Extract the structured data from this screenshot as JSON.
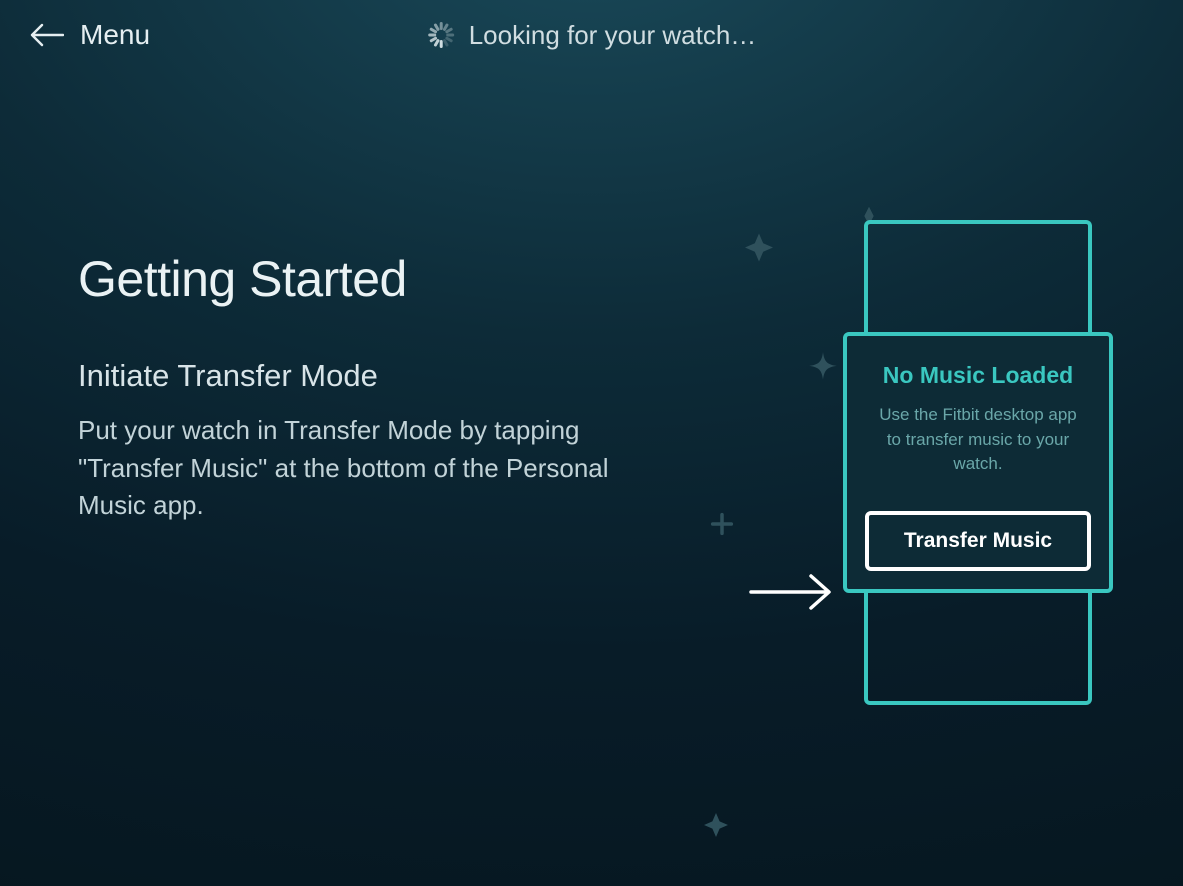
{
  "header": {
    "back_label": "Menu",
    "status_text": "Looking for your watch…"
  },
  "main": {
    "title": "Getting Started",
    "subtitle": "Initiate Transfer Mode",
    "body": "Put your watch in Transfer Mode by tapping \"Transfer Music\" at the bottom of the Personal Music app."
  },
  "watch": {
    "screen_title": "No Music Loaded",
    "screen_text": "Use the Fitbit desktop app to transfer music to your watch.",
    "button_label": "Transfer Music"
  },
  "colors": {
    "accent": "#3ac7c0",
    "text_primary": "#eaf2f4",
    "text_secondary": "#c2d3d8"
  }
}
